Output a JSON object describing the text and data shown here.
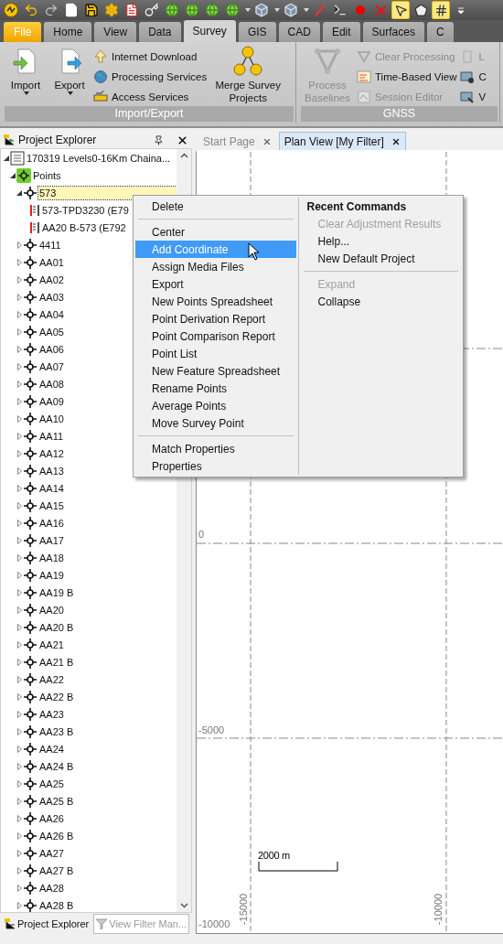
{
  "quick_access": [
    {
      "kind": "logo",
      "on": false
    },
    {
      "kind": "undo",
      "on": false
    },
    {
      "kind": "redo",
      "on": false
    },
    {
      "kind": "new",
      "on": false
    },
    {
      "kind": "save",
      "on": false
    },
    {
      "kind": "gear",
      "on": false
    },
    {
      "kind": "report",
      "on": false
    },
    {
      "kind": "key",
      "on": false
    },
    {
      "kind": "globe",
      "on": false
    },
    {
      "kind": "globe",
      "on": false
    },
    {
      "kind": "globe",
      "on": false
    },
    {
      "kind": "globe-menu",
      "on": false
    },
    {
      "kind": "cube-menu",
      "on": false
    },
    {
      "kind": "cube-menu",
      "on": false
    },
    {
      "kind": "line",
      "on": false
    },
    {
      "kind": "terminal",
      "on": false
    },
    {
      "kind": "record",
      "on": false
    },
    {
      "kind": "delete",
      "on": false
    },
    {
      "kind": "select",
      "on": true
    },
    {
      "kind": "polygon",
      "on": false
    },
    {
      "kind": "grid",
      "on": true
    },
    {
      "kind": "customize",
      "on": false
    }
  ],
  "ribbon_tabs": [
    {
      "label": "File",
      "kind": "backstage",
      "selected": false
    },
    {
      "label": "Home",
      "kind": "tab",
      "selected": false
    },
    {
      "label": "View",
      "kind": "tab",
      "selected": false
    },
    {
      "label": "Data",
      "kind": "tab",
      "selected": false
    },
    {
      "label": "Survey",
      "kind": "tab",
      "selected": true
    },
    {
      "label": "GIS",
      "kind": "tab",
      "selected": false
    },
    {
      "label": "CAD",
      "kind": "tab",
      "selected": false
    },
    {
      "label": "Edit",
      "kind": "tab",
      "selected": false
    },
    {
      "label": "Surfaces",
      "kind": "tab",
      "selected": false
    },
    {
      "label": "C",
      "kind": "tab",
      "selected": false
    }
  ],
  "ribbon_groups": [
    {
      "title": "Import/Export",
      "columns": [
        {
          "kind": "large",
          "label": "Import",
          "dropdown": true,
          "disabled": false
        },
        {
          "kind": "large",
          "label": "Export",
          "dropdown": true,
          "disabled": false
        },
        {
          "kind": "stack",
          "items": [
            {
              "label": "Internet Download",
              "disabled": false
            },
            {
              "label": "Processing Services",
              "disabled": false
            },
            {
              "label": "Access Services",
              "disabled": false
            }
          ]
        },
        {
          "kind": "large",
          "label": "Merge Survey Projects",
          "dropdown": false,
          "disabled": false
        }
      ]
    },
    {
      "title": "GNSS",
      "columns": [
        {
          "kind": "large",
          "label": "Process Baselines",
          "dropdown": false,
          "disabled": true
        },
        {
          "kind": "stack",
          "items": [
            {
              "label": "Clear Processing",
              "disabled": true
            },
            {
              "label": "Time-Based View",
              "disabled": false
            },
            {
              "label": "Session Editor",
              "disabled": true
            }
          ]
        },
        {
          "kind": "stack",
          "items": [
            {
              "label": "L",
              "disabled": true
            },
            {
              "label": "C",
              "disabled": false
            },
            {
              "label": "V",
              "disabled": false
            }
          ]
        }
      ]
    }
  ],
  "explorer": {
    "title": "Project Explorer",
    "tree": [
      {
        "label": "170319 Levels0-16Km Chaina...",
        "kind": "project",
        "expanded": true,
        "selected": false,
        "children": [
          {
            "label": "Points",
            "kind": "group",
            "expanded": true,
            "selected": false,
            "children": [
              {
                "label": "573",
                "kind": "point",
                "expanded": true,
                "selected": true,
                "children": [
                  {
                    "label": "573-TPD3230 (E79",
                    "kind": "observation",
                    "selected": false
                  },
                  {
                    "label": "AA20 B-573 (E792",
                    "kind": "observation",
                    "selected": false
                  }
                ]
              },
              {
                "label": "4411",
                "kind": "point",
                "expanded": false,
                "selected": false
              },
              {
                "label": "AA01",
                "kind": "point",
                "expanded": false,
                "selected": false
              },
              {
                "label": "AA02",
                "kind": "point",
                "expanded": false,
                "selected": false
              },
              {
                "label": "AA03",
                "kind": "point",
                "expanded": false,
                "selected": false
              },
              {
                "label": "AA04",
                "kind": "point",
                "expanded": false,
                "selected": false
              },
              {
                "label": "AA05",
                "kind": "point",
                "expanded": false,
                "selected": false
              },
              {
                "label": "AA06",
                "kind": "point",
                "expanded": false,
                "selected": false
              },
              {
                "label": "AA07",
                "kind": "point",
                "expanded": false,
                "selected": false
              },
              {
                "label": "AA08",
                "kind": "point",
                "expanded": false,
                "selected": false
              },
              {
                "label": "AA09",
                "kind": "point",
                "expanded": false,
                "selected": false
              },
              {
                "label": "AA10",
                "kind": "point",
                "expanded": false,
                "selected": false
              },
              {
                "label": "AA11",
                "kind": "point",
                "expanded": false,
                "selected": false
              },
              {
                "label": "AA12",
                "kind": "point",
                "expanded": false,
                "selected": false
              },
              {
                "label": "AA13",
                "kind": "point",
                "expanded": false,
                "selected": false
              },
              {
                "label": "AA14",
                "kind": "point",
                "expanded": false,
                "selected": false
              },
              {
                "label": "AA15",
                "kind": "point",
                "expanded": false,
                "selected": false
              },
              {
                "label": "AA16",
                "kind": "point",
                "expanded": false,
                "selected": false
              },
              {
                "label": "AA17",
                "kind": "point",
                "expanded": false,
                "selected": false
              },
              {
                "label": "AA18",
                "kind": "point",
                "expanded": false,
                "selected": false
              },
              {
                "label": "AA19",
                "kind": "point",
                "expanded": false,
                "selected": false
              },
              {
                "label": "AA19 B",
                "kind": "point",
                "expanded": false,
                "selected": false
              },
              {
                "label": "AA20",
                "kind": "point",
                "expanded": false,
                "selected": false
              },
              {
                "label": "AA20 B",
                "kind": "point",
                "expanded": false,
                "selected": false
              },
              {
                "label": "AA21",
                "kind": "point",
                "expanded": false,
                "selected": false
              },
              {
                "label": "AA21 B",
                "kind": "point",
                "expanded": false,
                "selected": false
              },
              {
                "label": "AA22",
                "kind": "point",
                "expanded": false,
                "selected": false
              },
              {
                "label": "AA22 B",
                "kind": "point",
                "expanded": false,
                "selected": false
              },
              {
                "label": "AA23",
                "kind": "point",
                "expanded": false,
                "selected": false
              },
              {
                "label": "AA23 B",
                "kind": "point",
                "expanded": false,
                "selected": false
              },
              {
                "label": "AA24",
                "kind": "point",
                "expanded": false,
                "selected": false
              },
              {
                "label": "AA24 B",
                "kind": "point",
                "expanded": false,
                "selected": false
              },
              {
                "label": "AA25",
                "kind": "point",
                "expanded": false,
                "selected": false
              },
              {
                "label": "AA25 B",
                "kind": "point",
                "expanded": false,
                "selected": false
              },
              {
                "label": "AA26",
                "kind": "point",
                "expanded": false,
                "selected": false
              },
              {
                "label": "AA26 B",
                "kind": "point",
                "expanded": false,
                "selected": false
              },
              {
                "label": "AA27",
                "kind": "point",
                "expanded": false,
                "selected": false
              },
              {
                "label": "AA27 B",
                "kind": "point",
                "expanded": false,
                "selected": false
              },
              {
                "label": "AA28",
                "kind": "point",
                "expanded": false,
                "selected": false
              },
              {
                "label": "AA28 B",
                "kind": "point",
                "expanded": false,
                "selected": false
              }
            ]
          }
        ]
      }
    ],
    "bottom_tabs": [
      {
        "label": "Project Explorer",
        "selected": true
      },
      {
        "label": "View Filter Man...",
        "selected": false
      }
    ]
  },
  "document_tabs": [
    {
      "label": "Start Page",
      "selected": false
    },
    {
      "label": "Plan View [My Filter]",
      "selected": true
    }
  ],
  "plan_view": {
    "y_labels": [
      "0",
      "-5000",
      "-10000"
    ],
    "x_labels": [
      "-15000",
      "-10000"
    ],
    "scale_bar": "2000 m"
  },
  "context_menu": {
    "groups": [
      [
        {
          "label": "Delete",
          "selected": false,
          "disabled": false
        }
      ],
      [
        {
          "label": "Center",
          "selected": false,
          "disabled": false
        },
        {
          "label": "Add Coordinate",
          "selected": true,
          "disabled": false
        },
        {
          "label": "Assign Media Files",
          "selected": false,
          "disabled": false
        },
        {
          "label": "Export",
          "selected": false,
          "disabled": false
        },
        {
          "label": "New Points Spreadsheet",
          "selected": false,
          "disabled": false
        },
        {
          "label": "Point Derivation Report",
          "selected": false,
          "disabled": false
        },
        {
          "label": "Point Comparison Report",
          "selected": false,
          "disabled": false
        },
        {
          "label": "Point List",
          "selected": false,
          "disabled": false
        },
        {
          "label": "New Feature Spreadsheet",
          "selected": false,
          "disabled": false
        },
        {
          "label": "Rename Points",
          "selected": false,
          "disabled": false
        },
        {
          "label": "Average Points",
          "selected": false,
          "disabled": false
        },
        {
          "label": "Move Survey Point",
          "selected": false,
          "disabled": false
        }
      ],
      [
        {
          "label": "Match Properties",
          "selected": false,
          "disabled": false
        },
        {
          "label": "Properties",
          "selected": false,
          "disabled": false
        }
      ]
    ],
    "recent_title": "Recent Commands",
    "recent_groups": [
      [
        {
          "label": "Clear Adjustment Results",
          "selected": false,
          "disabled": true
        },
        {
          "label": "Help...",
          "selected": false,
          "disabled": false
        },
        {
          "label": "New Default Project",
          "selected": false,
          "disabled": false
        }
      ],
      [
        {
          "label": "Expand",
          "selected": false,
          "disabled": true
        },
        {
          "label": "Collapse",
          "selected": false,
          "disabled": false
        }
      ]
    ]
  }
}
